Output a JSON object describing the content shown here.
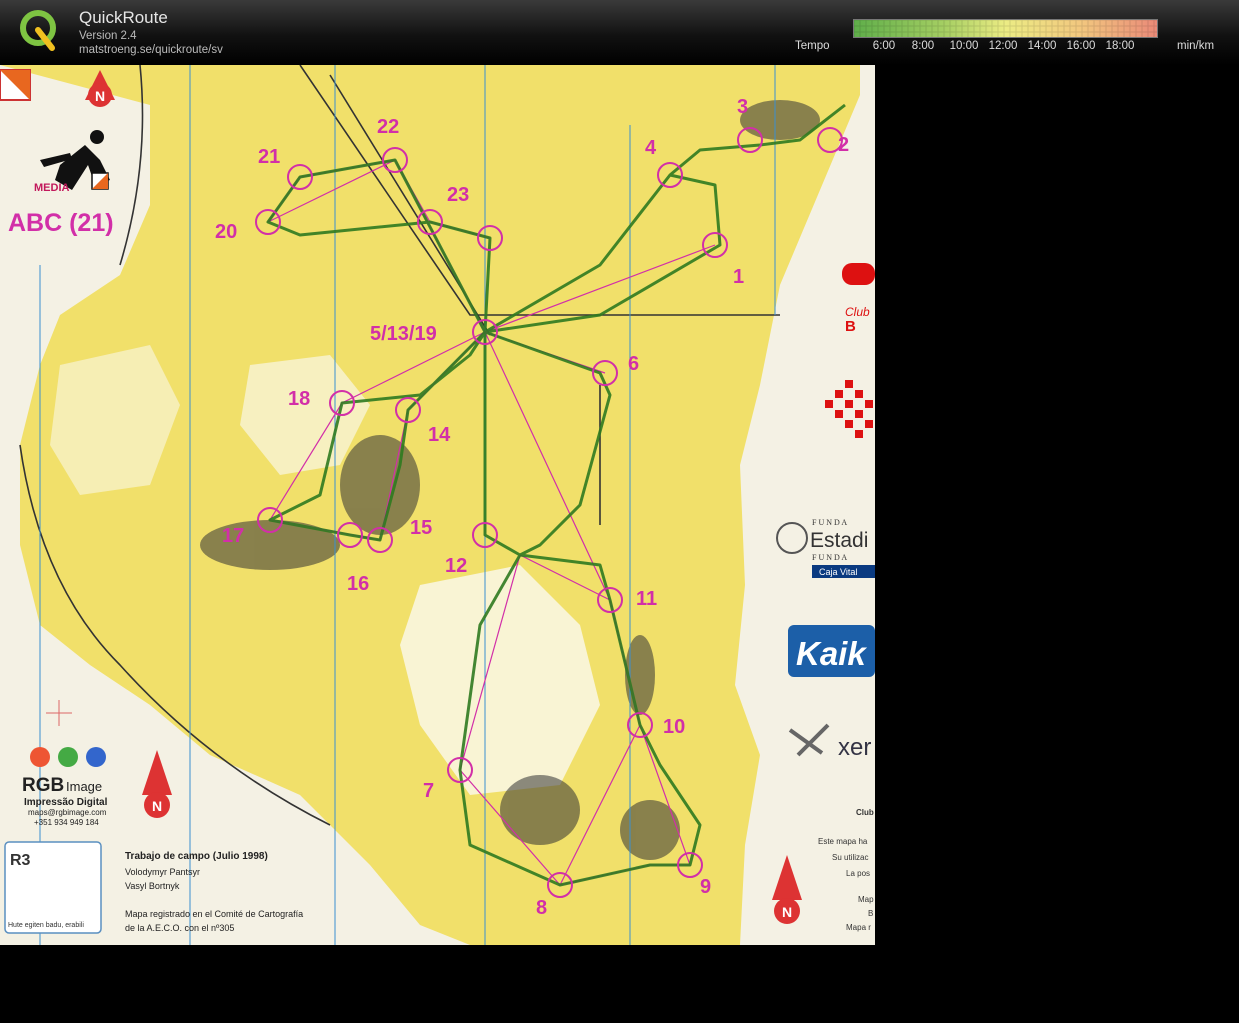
{
  "header": {
    "title": "QuickRoute",
    "version": "Version 2.4",
    "url": "matstroeng.se/quickroute/sv"
  },
  "legend": {
    "label": "Tempo",
    "unit": "min/km",
    "ticks": [
      "6:00",
      "8:00",
      "10:00",
      "12:00",
      "14:00",
      "16:00",
      "18:00"
    ],
    "colors": [
      "#5fae4a",
      "#a6cf63",
      "#ecec84",
      "#f2c77f",
      "#ea8a78"
    ]
  },
  "map": {
    "header_text": "ABC (21)",
    "brand_media": "MEDIA",
    "control_labels": [
      "1",
      "2",
      "3",
      "4",
      "5/13/19",
      "6",
      "7",
      "8",
      "9",
      "10",
      "11",
      "12",
      "14",
      "15",
      "16",
      "17",
      "18",
      "20",
      "21",
      "22",
      "23"
    ],
    "club_text": "Club",
    "club_letter": "B",
    "estadio_text": "Estadi",
    "funda_top": "F U N D A",
    "funda_bottom": "F U N D A",
    "caja_vital": "Caja Vital",
    "kaik_text": "Kaik",
    "xer_text": "xer",
    "rgb_name": "RGB",
    "rgb_image": "Image",
    "rgb_sub": "Impressão Digital",
    "rgb_email": "maps@rgbimage.com",
    "rgb_phone": "+351 934 949 184",
    "r3": "R3",
    "r3_note": "Hute egiten badu, erabili",
    "credits_title": "Trabajo de campo (Julio 1998)",
    "credit_1": "Volodymyr Pantsyr",
    "credit_2": "Vasyl Bortnyk",
    "registro_1": "Mapa registrado en el Comité de Cartografía",
    "registro_2": "de la A.E.C.O. con el nº305",
    "right_notes": [
      "Club",
      "Este mapa ha",
      "Su utilizac",
      "La pos",
      "Map",
      "B",
      "Mapa r"
    ],
    "north_label": "N"
  }
}
